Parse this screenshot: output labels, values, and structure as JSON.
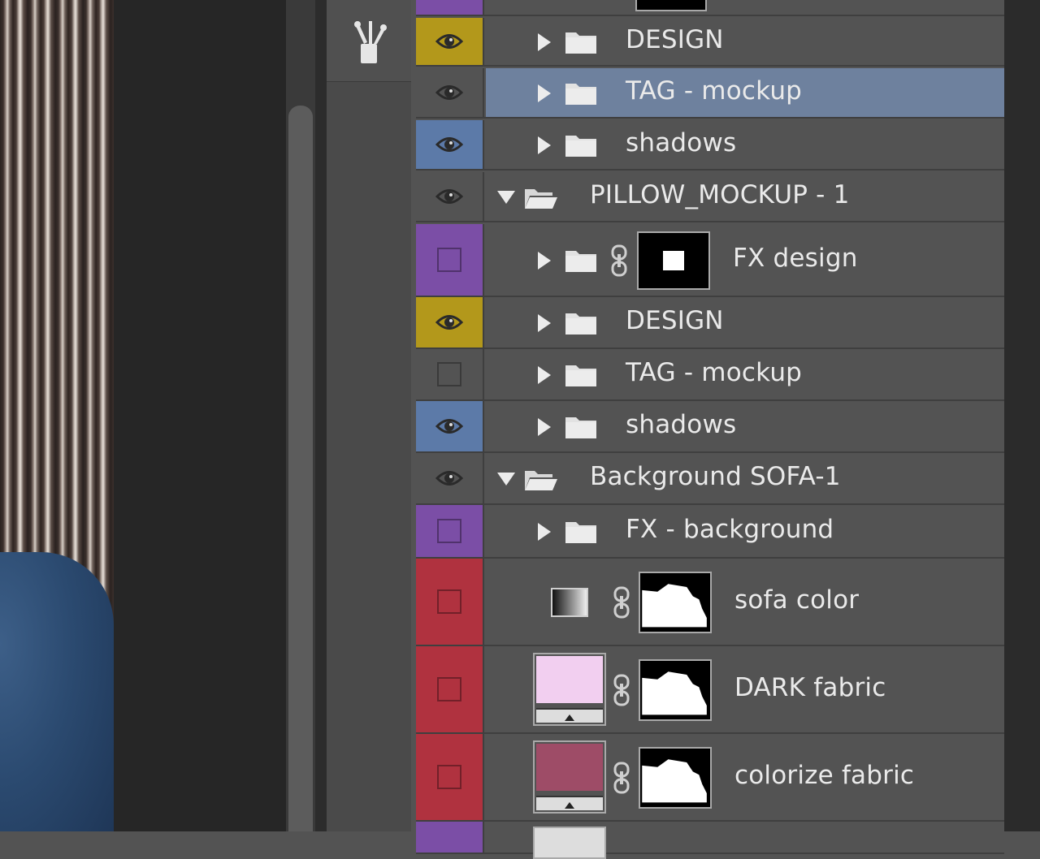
{
  "colors": {
    "violet": "#7b4ea6",
    "yellow": "#b3981b",
    "blue": "#5c7aa8",
    "red": "#b0323f",
    "none": "#535353",
    "selected": "#6e819e"
  },
  "toolstrip": {
    "tool_icon": "brush-settings-icon"
  },
  "layers": [
    {
      "name": "DESIGN",
      "color": "yellow",
      "visible": true,
      "kind": "group",
      "expanded": false
    },
    {
      "name": "TAG - mockup",
      "color": "none",
      "visible": true,
      "kind": "group",
      "expanded": false,
      "selected": true
    },
    {
      "name": "shadows",
      "color": "blue",
      "visible": true,
      "kind": "group",
      "expanded": false
    },
    {
      "name": "PILLOW_MOCKUP - 1",
      "color": "none",
      "visible": true,
      "kind": "group",
      "expanded": true
    },
    {
      "name": "FX design",
      "color": "violet",
      "visible": false,
      "kind": "group-mask",
      "expanded": false
    },
    {
      "name": "DESIGN",
      "color": "yellow",
      "visible": true,
      "kind": "group",
      "expanded": false
    },
    {
      "name": "TAG - mockup",
      "color": "none",
      "visible": false,
      "kind": "group",
      "expanded": false
    },
    {
      "name": "shadows",
      "color": "blue",
      "visible": true,
      "kind": "group",
      "expanded": false
    },
    {
      "name": "Background SOFA-1",
      "color": "none",
      "visible": true,
      "kind": "group",
      "expanded": true
    },
    {
      "name": "FX - background",
      "color": "violet",
      "visible": false,
      "kind": "group",
      "expanded": false
    },
    {
      "name": "sofa color",
      "color": "red",
      "visible": false,
      "kind": "gradient-map",
      "expanded": false
    },
    {
      "name": "DARK fabric",
      "color": "red",
      "visible": false,
      "kind": "fill",
      "swatch": "#f2cff0",
      "expanded": false
    },
    {
      "name": "colorize fabric",
      "color": "red",
      "visible": false,
      "kind": "fill",
      "swatch": "#9e4c67",
      "expanded": false
    }
  ]
}
